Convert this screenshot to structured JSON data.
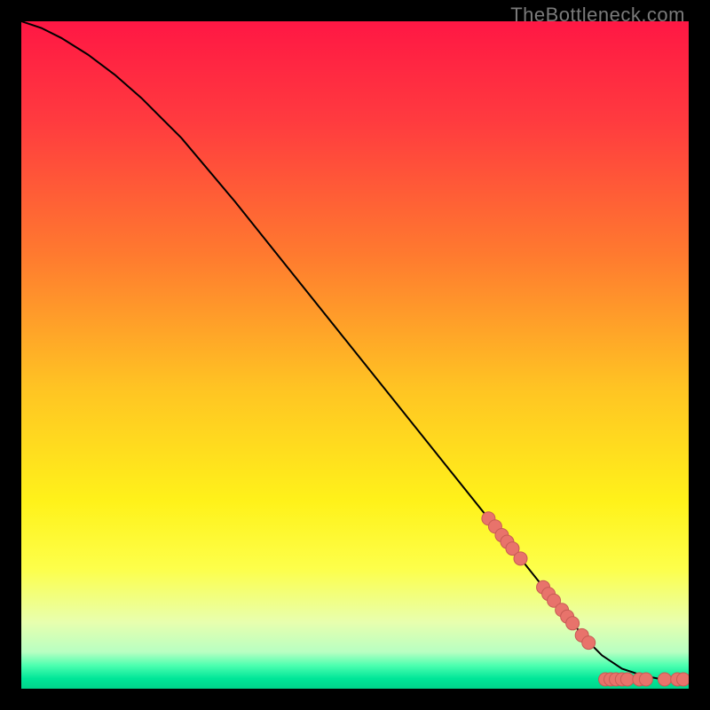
{
  "watermark": "TheBottleneck.com",
  "colors": {
    "background": "#000000",
    "curve": "#000000",
    "marker_fill": "#e8736b",
    "marker_stroke": "#c75b54",
    "gradient_stops": [
      {
        "offset": 0.0,
        "color": "#ff1744"
      },
      {
        "offset": 0.15,
        "color": "#ff3b3f"
      },
      {
        "offset": 0.35,
        "color": "#ff7a2f"
      },
      {
        "offset": 0.55,
        "color": "#ffc423"
      },
      {
        "offset": 0.72,
        "color": "#fff21a"
      },
      {
        "offset": 0.82,
        "color": "#fdff4a"
      },
      {
        "offset": 0.9,
        "color": "#e8ffae"
      },
      {
        "offset": 0.945,
        "color": "#b8ffc2"
      },
      {
        "offset": 0.965,
        "color": "#4dffb0"
      },
      {
        "offset": 0.985,
        "color": "#00e698"
      },
      {
        "offset": 1.0,
        "color": "#00d48a"
      }
    ]
  },
  "chart_data": {
    "type": "line",
    "title": "",
    "xlabel": "",
    "ylabel": "",
    "xlim": [
      0,
      100
    ],
    "ylim": [
      0,
      100
    ],
    "series": [
      {
        "name": "curve",
        "x": [
          0,
          3,
          6,
          10,
          14,
          18,
          24,
          32,
          40,
          48,
          56,
          64,
          72,
          78,
          82,
          85,
          87,
          90,
          93,
          96,
          100
        ],
        "y": [
          100,
          99,
          97.5,
          95,
          92,
          88.5,
          82.5,
          73,
          63,
          53,
          43,
          33,
          23,
          15.5,
          10.5,
          7,
          5,
          3,
          2,
          1.4,
          1.3
        ]
      }
    ],
    "markers": [
      {
        "x": 70.0,
        "y": 25.5
      },
      {
        "x": 71.0,
        "y": 24.3
      },
      {
        "x": 72.0,
        "y": 23.0
      },
      {
        "x": 72.8,
        "y": 22.0
      },
      {
        "x": 73.6,
        "y": 21.0
      },
      {
        "x": 74.8,
        "y": 19.5
      },
      {
        "x": 78.2,
        "y": 15.2
      },
      {
        "x": 79.0,
        "y": 14.2
      },
      {
        "x": 79.8,
        "y": 13.2
      },
      {
        "x": 81.0,
        "y": 11.8
      },
      {
        "x": 81.8,
        "y": 10.8
      },
      {
        "x": 82.6,
        "y": 9.8
      },
      {
        "x": 84.0,
        "y": 8.0
      },
      {
        "x": 85.0,
        "y": 6.9
      },
      {
        "x": 87.5,
        "y": 1.4
      },
      {
        "x": 88.3,
        "y": 1.4
      },
      {
        "x": 89.1,
        "y": 1.4
      },
      {
        "x": 90.0,
        "y": 1.4
      },
      {
        "x": 90.8,
        "y": 1.4
      },
      {
        "x": 92.6,
        "y": 1.4
      },
      {
        "x": 93.6,
        "y": 1.4
      },
      {
        "x": 96.4,
        "y": 1.4
      },
      {
        "x": 98.3,
        "y": 1.4
      },
      {
        "x": 99.2,
        "y": 1.4
      }
    ]
  }
}
